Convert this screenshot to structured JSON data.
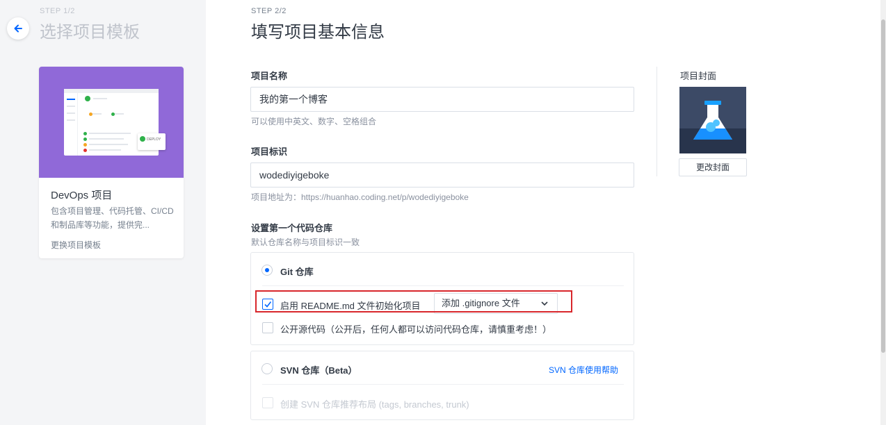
{
  "left": {
    "step": "STEP 1/2",
    "title": "选择项目模板",
    "card": {
      "title": "DevOps 项目",
      "desc": "包含项目管理、代码托管、CI/CD 和制品库等功能，提供完...",
      "deploy": "DEPLOY",
      "change_link": "更换项目模板"
    }
  },
  "right": {
    "step": "STEP 2/2",
    "title": "填写项目基本信息",
    "name": {
      "label": "项目名称",
      "value": "我的第一个博客",
      "hint": "可以使用中英文、数字、空格组合"
    },
    "ident": {
      "label": "项目标识",
      "value": "wodediyigeboke",
      "hint": "项目地址为：https://huanhao.coding.net/p/wodediyigeboke"
    },
    "repo": {
      "label": "设置第一个代码仓库",
      "hint": "默认仓库名称与项目标识一致",
      "git": {
        "title": "Git 仓库",
        "readme": "启用 README.md 文件初始化项目",
        "gitignore": "添加 .gitignore 文件",
        "open_source": "公开源代码（公开后，任何人都可以访问代码仓库，请慎重考虑！）"
      },
      "svn": {
        "title": "SVN 仓库（Beta）",
        "help": "SVN 仓库使用帮助",
        "layout": "创建 SVN 仓库推荐布局 (tags, branches, trunk)"
      }
    },
    "cover": {
      "label": "项目封面",
      "button": "更改封面"
    }
  },
  "colors": {
    "accent": "#0066ff",
    "card_cover": "#9069d8",
    "highlight": "#d8262b"
  }
}
